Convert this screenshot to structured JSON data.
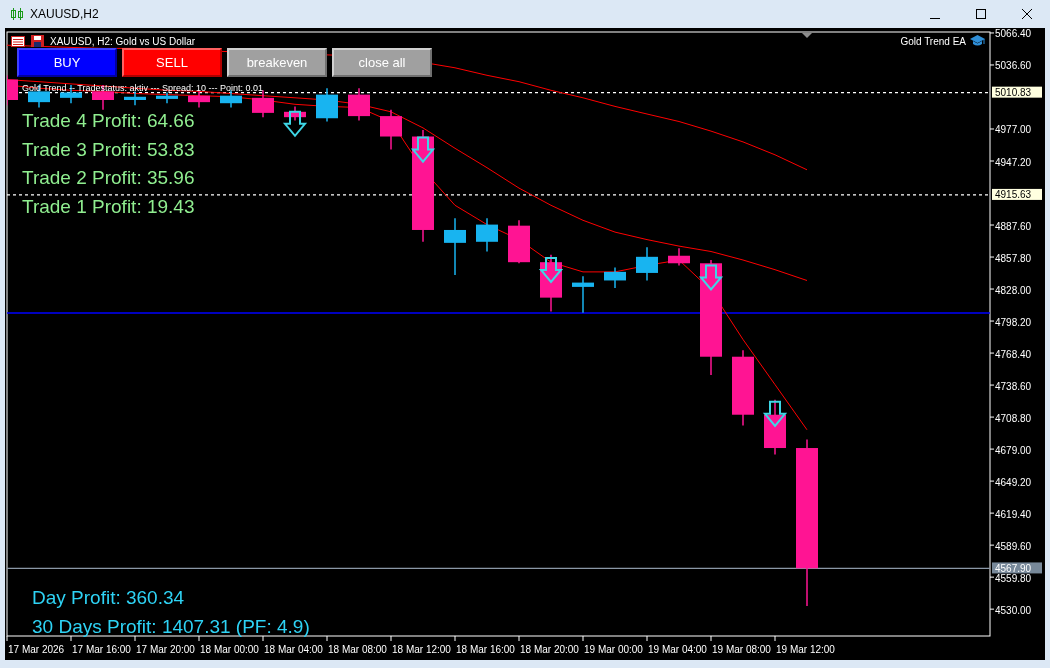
{
  "window": {
    "title": "XAUUSD,H2"
  },
  "chart": {
    "header": "XAUUSD, H2:  Gold vs US Dollar",
    "expert_name": "Gold Trend EA",
    "status_line": "Gold Trend -- Tradestatus: aktiv --- Spread: 10 --- Point: 0.01",
    "buttons": [
      {
        "label": "BUY",
        "kind": "buy"
      },
      {
        "label": "SELL",
        "kind": "sell"
      },
      {
        "label": "breakeven",
        "kind": "neutral"
      },
      {
        "label": "close all",
        "kind": "neutral"
      }
    ],
    "trade_profits": [
      "Trade 4 Profit: 64.66",
      "Trade 3 Profit: 53.83",
      "Trade 2 Profit: 35.96",
      "Trade 1 Profit: 19.43"
    ],
    "summary": [
      "Day Profit: 360.34",
      "30 Days Profit: 1407.31 (PF: 4.9)"
    ],
    "price_axis": [
      "5066.40",
      "5036.60",
      "4977.00",
      "4947.20",
      "4887.60",
      "4857.80",
      "4828.00",
      "4798.20",
      "4768.40",
      "4738.60",
      "4708.80",
      "4679.00",
      "4649.20",
      "4619.40",
      "4589.60",
      "4559.80",
      "4530.00"
    ],
    "price_tags": [
      {
        "label": "5010.83",
        "kind": "level"
      },
      {
        "label": "4915.63",
        "kind": "level"
      },
      {
        "label": "4567.90",
        "kind": "bid"
      }
    ],
    "time_axis": [
      "17 Mar 2026",
      "17 Mar 16:00",
      "17 Mar 20:00",
      "18 Mar 00:00",
      "18 Mar 04:00",
      "18 Mar 08:00",
      "18 Mar 12:00",
      "18 Mar 16:00",
      "18 Mar 20:00",
      "19 Mar 00:00",
      "19 Mar 04:00",
      "19 Mar 08:00",
      "19 Mar 12:00"
    ]
  }
}
